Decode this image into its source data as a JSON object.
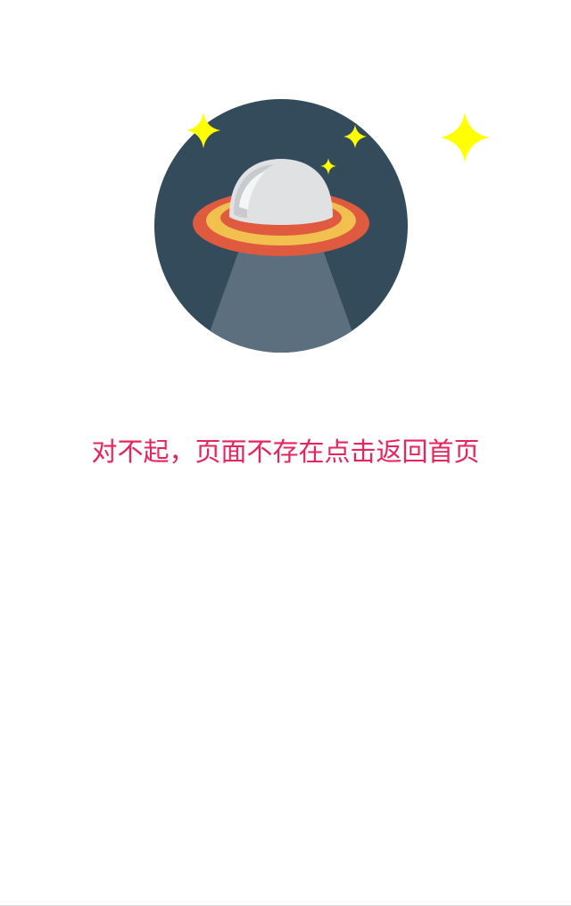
{
  "error_page": {
    "illustration_icon": "ufo-spaceship-icon",
    "message": "对不起，页面不存在点击返回首页",
    "message_color": "#e8245d"
  },
  "colors": {
    "circle_background": "#344b5c",
    "beam": "#5c6f7f",
    "saucer_outer_ring": "#e05a40",
    "saucer_inner_ring": "#f2c04f",
    "dome": "#dfe1e2",
    "star": "#ffff00"
  }
}
